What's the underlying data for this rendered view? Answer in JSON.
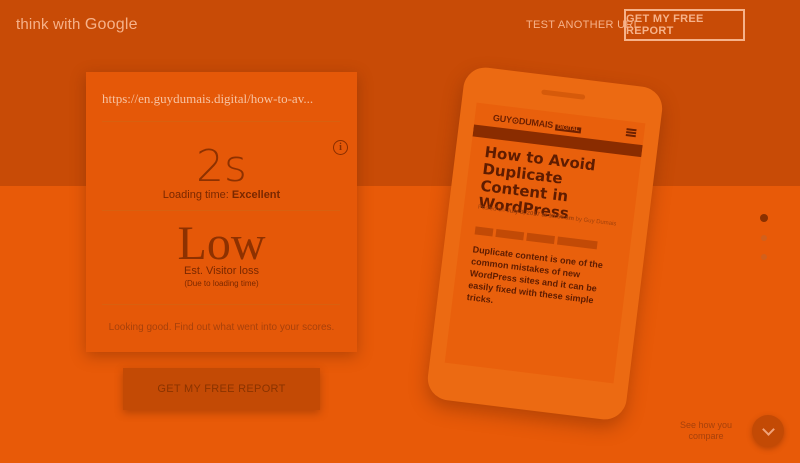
{
  "header": {
    "logo_prefix": "think with ",
    "logo_brand": "Google",
    "test_link": "TEST ANOTHER URL",
    "report_button": "GET MY FREE REPORT"
  },
  "card": {
    "url": "https://en.guydumais.digital/how-to-av...",
    "info_icon": "info-icon",
    "time_value": "2s",
    "loading_label": "Loading time: ",
    "loading_rating": "Excellent",
    "loss_value": "Low",
    "loss_label": "Est. Visitor loss",
    "loss_note": "(Due to loading time)",
    "footer": "Looking good. Find out what went into your scores."
  },
  "cta": {
    "label": "GET MY FREE REPORT"
  },
  "phone": {
    "brand": "GUY⊙DUMAIS",
    "brand_suffix": "DIGITAL",
    "post_title": "How to Avoid Duplicate Content in WordPress",
    "post_meta_prefix": "Posted on ",
    "post_meta_date": "July 3, 2017 at 10:56 am",
    "post_meta_by": " by Guy Dumais",
    "post_lead": "Duplicate content is one of the common mistakes of new WordPress sites and it can be easily fixed with these simple tricks."
  },
  "pagination": {
    "active_index": 0,
    "count": 3
  },
  "see_how": "See how you compare",
  "colors": {
    "band_top": "#c84b06",
    "band_bottom": "#e85a08",
    "text_light": "#f6b28a",
    "text_dark": "#8e3100"
  }
}
